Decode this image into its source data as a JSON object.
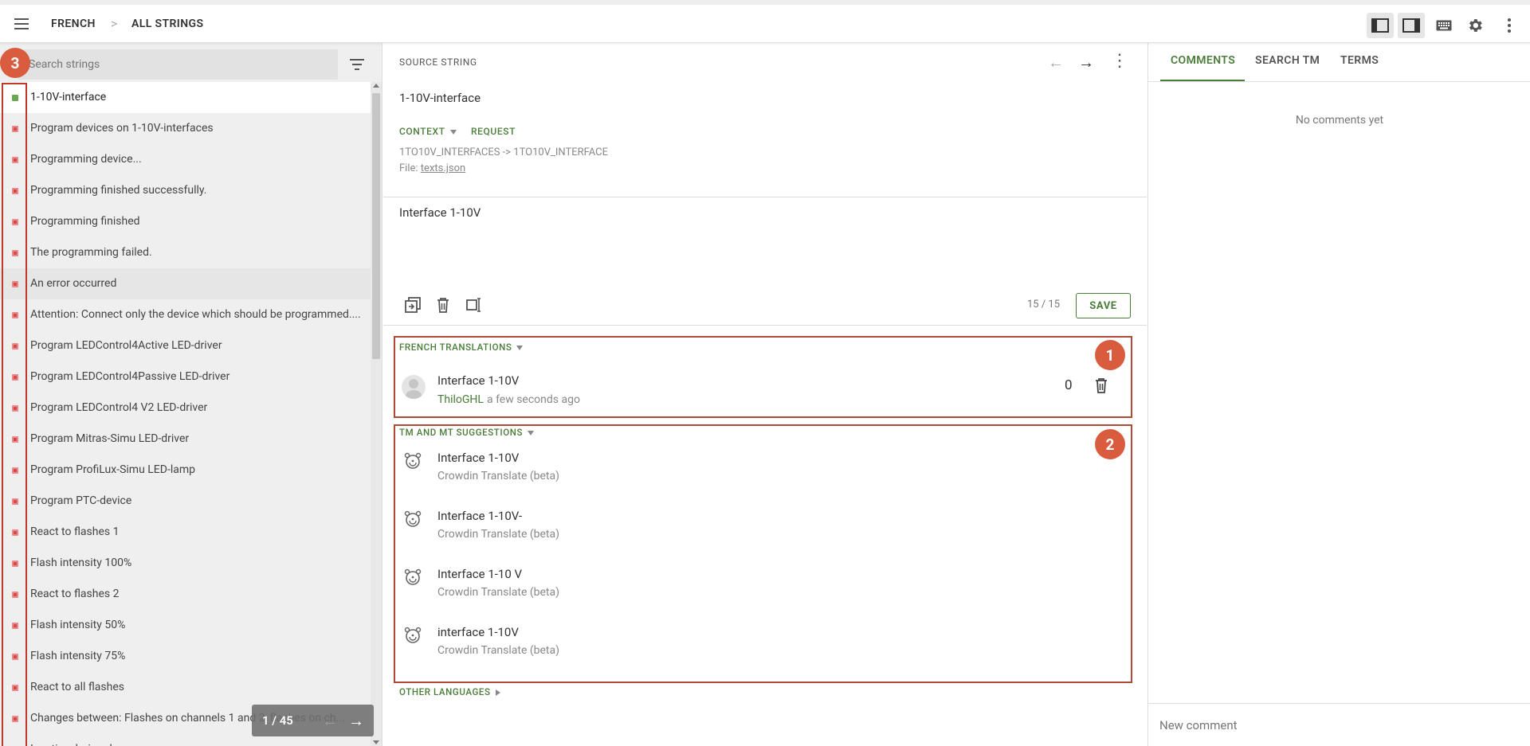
{
  "header": {
    "breadcrumb": [
      "FRENCH",
      "ALL STRINGS"
    ],
    "breadcrumb_separator": ">"
  },
  "left_panel": {
    "search_placeholder": "Search strings",
    "badge": "3",
    "strings": [
      {
        "text": "1-10V-interface",
        "status": "translated"
      },
      {
        "text": "Program devices on 1-10V-interfaces",
        "status": "untranslated"
      },
      {
        "text": "Programming device...",
        "status": "untranslated"
      },
      {
        "text": "Programming finished successfully.",
        "status": "untranslated"
      },
      {
        "text": "Programming finished",
        "status": "untranslated"
      },
      {
        "text": "The programming failed.",
        "status": "untranslated"
      },
      {
        "text": "An error occurred",
        "status": "untranslated"
      },
      {
        "text": "Attention: Connect only the device which should be programmed....",
        "status": "untranslated"
      },
      {
        "text": "Program LEDControl4Active LED-driver",
        "status": "untranslated"
      },
      {
        "text": "Program LEDControl4Passive LED-driver",
        "status": "untranslated"
      },
      {
        "text": "Program LEDControl4 V2 LED-driver",
        "status": "untranslated"
      },
      {
        "text": "Program Mitras-Simu LED-driver",
        "status": "untranslated"
      },
      {
        "text": "Program ProfiLux-Simu LED-lamp",
        "status": "untranslated"
      },
      {
        "text": "Program PTC-device",
        "status": "untranslated"
      },
      {
        "text": "React to flashes 1",
        "status": "untranslated"
      },
      {
        "text": "Flash intensity 100%",
        "status": "untranslated"
      },
      {
        "text": "React to flashes 2",
        "status": "untranslated"
      },
      {
        "text": "Flash intensity 50%",
        "status": "untranslated"
      },
      {
        "text": "Flash intensity 75%",
        "status": "untranslated"
      },
      {
        "text": "React to all flashes",
        "status": "untranslated"
      },
      {
        "text": "Changes between: Flashes on channels 1 and 2, flashes on ch...",
        "status": "untranslated"
      },
      {
        "text": "Inactive during day",
        "status": "untranslated"
      }
    ],
    "pager": {
      "text": "1 / 45",
      "prev": "←",
      "next": "→"
    }
  },
  "source": {
    "heading": "SOURCE STRING",
    "text": "1-10V-interface",
    "context_label": "CONTEXT",
    "request_label": "REQUEST",
    "key_path": "1TO10V_INTERFACES -> 1TO10V_INTERFACE",
    "file_prefix": "File:",
    "file_name": "texts.json",
    "nav_prev": "←",
    "nav_next": "→",
    "more": "⋮"
  },
  "editor": {
    "value": "Interface 1-10V",
    "char_count": "15 / 15",
    "save_label": "SAVE"
  },
  "translations": {
    "heading": "FRENCH TRANSLATIONS",
    "badge": "1",
    "items": [
      {
        "text": "Interface 1-10V",
        "user": "ThiloGHL",
        "time": "a few seconds ago",
        "votes": "0"
      }
    ]
  },
  "suggestions": {
    "heading": "TM AND MT SUGGESTIONS",
    "badge": "2",
    "items": [
      {
        "text": "Interface 1-10V",
        "source": "Crowdin Translate (beta)"
      },
      {
        "text": "Interface 1-10V-",
        "source": "Crowdin Translate (beta)"
      },
      {
        "text": "Interface 1-10 V",
        "source": "Crowdin Translate (beta)"
      },
      {
        "text": "interface 1-10V",
        "source": "Crowdin Translate (beta)"
      }
    ]
  },
  "other_languages": {
    "heading": "OTHER LANGUAGES"
  },
  "right_panel": {
    "tabs": [
      "COMMENTS",
      "SEARCH TM",
      "TERMS"
    ],
    "active_tab": "COMMENTS",
    "empty_text": "No comments yet",
    "comment_placeholder": "New comment"
  },
  "colors": {
    "accent_green": "#4a7c3a",
    "annotation_red": "#b14a35",
    "badge_orange": "#d95c3f"
  }
}
